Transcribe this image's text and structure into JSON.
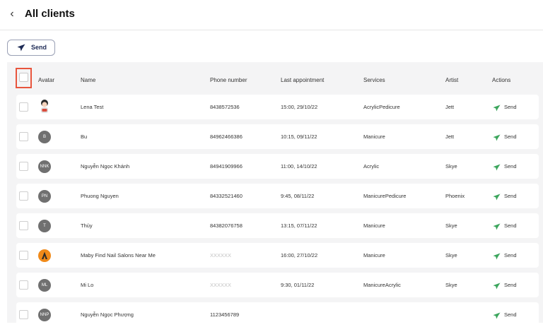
{
  "header": {
    "back_icon": "chevron-left-icon",
    "title": "All clients"
  },
  "toolbar": {
    "send_label": "Send",
    "send_icon": "paper-plane-icon"
  },
  "table": {
    "columns": {
      "avatar": "Avatar",
      "name": "Name",
      "phone": "Phone number",
      "last": "Last appointment",
      "services": "Services",
      "artist": "Artist",
      "actions": "Actions"
    },
    "rows": [
      {
        "avatar": "",
        "avatar_type": "illustration",
        "name": "Lena Test",
        "phone": "8438572536",
        "last": "15:00, 29/10/22",
        "services": "AcrylicPedicure",
        "artist": "Jett",
        "action": "Send"
      },
      {
        "avatar": "B",
        "name": "Bu",
        "phone": "84962466386",
        "last": "10:15, 09/11/22",
        "services": "Manicure",
        "artist": "Jett",
        "action": "Send"
      },
      {
        "avatar": "NNK",
        "name": "Nguyễn Ngọc Khánh",
        "phone": "84941909966",
        "last": "11:00, 14/10/22",
        "services": "Acrylic",
        "artist": "Skye",
        "action": "Send"
      },
      {
        "avatar": "PN",
        "name": "Phuong Nguyen",
        "phone": "84332521460",
        "last": "9:45, 08/11/22",
        "services": "ManicurePedicure",
        "artist": "Phoenix",
        "action": "Send"
      },
      {
        "avatar": "T",
        "name": "Thủy",
        "phone": "84382076758",
        "last": "13:15, 07/11/22",
        "services": "Manicure",
        "artist": "Skye",
        "action": "Send"
      },
      {
        "avatar": "",
        "avatar_type": "logo",
        "name": "Maby Find Nail Salons Near Me",
        "phone": "XXXXXX",
        "phone_masked": true,
        "last": "16:00, 27/10/22",
        "services": "Manicure",
        "artist": "Skye",
        "action": "Send"
      },
      {
        "avatar": "ML",
        "name": "Mi Lo",
        "phone": "XXXXXX",
        "phone_masked": true,
        "last": "9:30, 01/11/22",
        "services": "ManicureAcrylic",
        "artist": "Skye",
        "action": "Send"
      },
      {
        "avatar": "NNP",
        "name": "Nguyễn Ngọc Phượng",
        "phone": "1123456789",
        "last": "",
        "services": "",
        "artist": "",
        "action": "Send"
      }
    ]
  },
  "colors": {
    "accent_send": "#3ba55c",
    "primary_dark": "#1d2a55",
    "highlight_outline": "#e8553d",
    "avatar_bg": "#707070"
  }
}
